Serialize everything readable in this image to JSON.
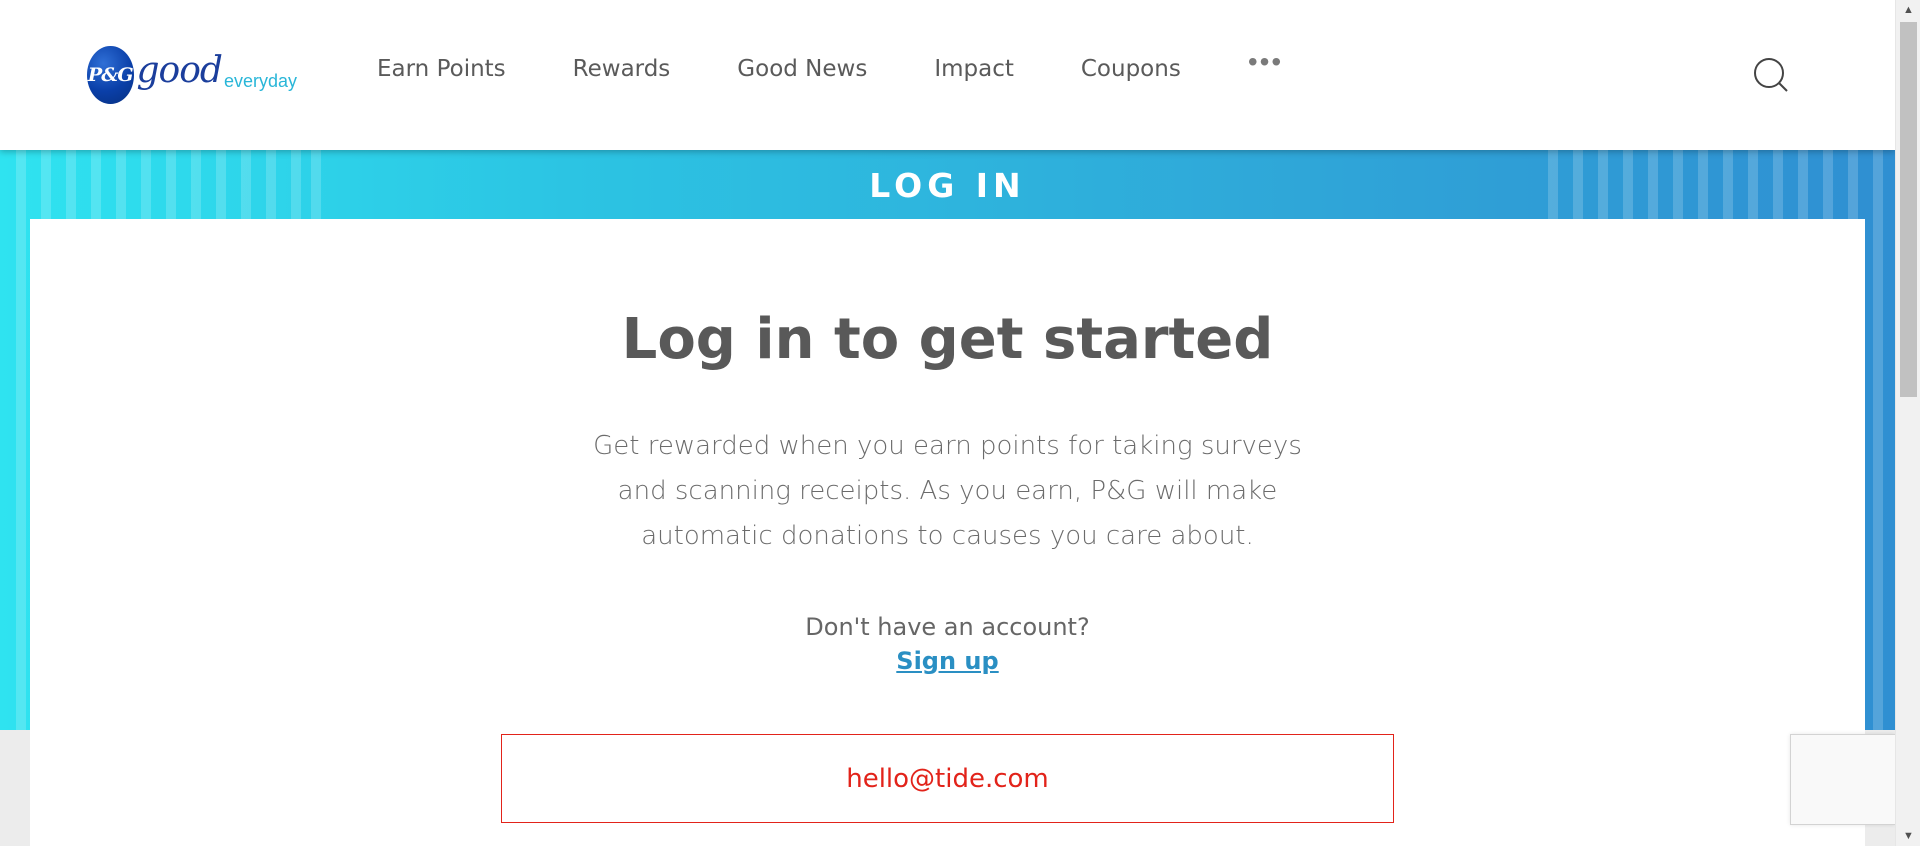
{
  "header": {
    "logo": {
      "badge": "P&G",
      "word": "good",
      "suffix": "everyday"
    },
    "nav": [
      {
        "label": "Earn Points"
      },
      {
        "label": "Rewards"
      },
      {
        "label": "Good News"
      },
      {
        "label": "Impact"
      },
      {
        "label": "Coupons"
      }
    ],
    "more_label": "•••",
    "search_icon": "search-icon"
  },
  "banner": {
    "title": "LOG IN"
  },
  "login": {
    "heading": "Log in to get started",
    "description": "Get rewarded when you earn points for taking surveys and scanning receipts. As you earn, P&G will make automatic donations to causes you care about.",
    "signup_prompt": "Don't have an account?",
    "signup_link": "Sign up",
    "email_value": "hello@tide.com"
  },
  "colors": {
    "accent": "#2a8fc3",
    "error": "#e2231a",
    "banner_start": "#2fe3f0",
    "banner_end": "#2f8fd2"
  }
}
